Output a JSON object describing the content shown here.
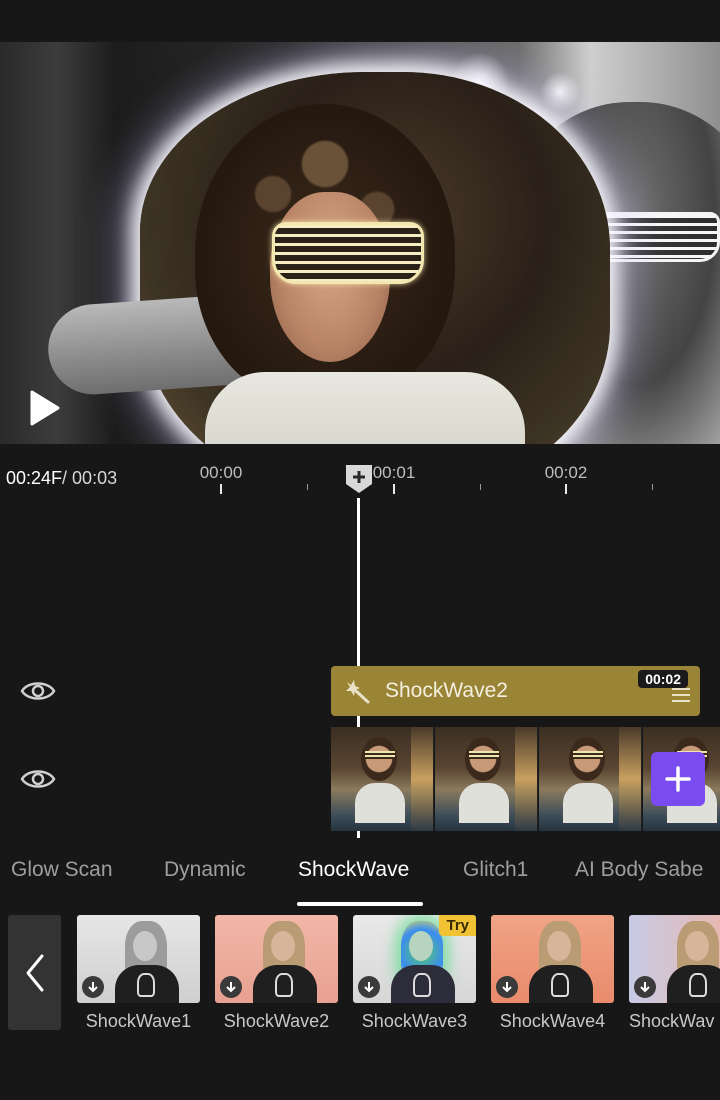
{
  "preview": {
    "play_icon": "play-icon"
  },
  "timeline": {
    "current_time": "00:24F",
    "total_time": "/ 00:03",
    "ticks": [
      "00:00",
      "00:01",
      "00:02"
    ],
    "playhead_icon": "plus-marker-icon"
  },
  "tracks": {
    "effect_clip": {
      "name": "ShockWave2",
      "duration": "00:02",
      "icon": "magic-wand-icon",
      "menu_icon": "drag-handle-icon",
      "color": "#9a8436"
    },
    "visibility_icon": "eye-icon",
    "add_button_icon": "plus-icon",
    "add_button_color": "#7a4cf0"
  },
  "categories": {
    "tabs": [
      "Glow Scan",
      "Dynamic",
      "ShockWave",
      "Glitch1",
      "AI Body Sabe"
    ],
    "active": "ShockWave"
  },
  "effects": {
    "back_icon": "chevron-left-icon",
    "items": [
      {
        "label": "ShockWave1",
        "badge": ""
      },
      {
        "label": "ShockWave2",
        "badge": ""
      },
      {
        "label": "ShockWave3",
        "badge": "Try"
      },
      {
        "label": "ShockWave4",
        "badge": ""
      },
      {
        "label": "ShockWav",
        "badge": ""
      }
    ],
    "badge_color": "#f1c233"
  }
}
